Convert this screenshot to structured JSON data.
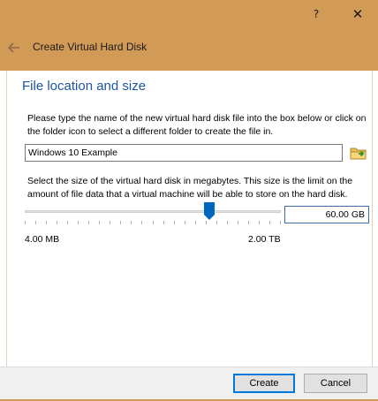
{
  "window": {
    "help_label": "?",
    "close_label": "✕",
    "wizard_title": "Create Virtual Hard Disk",
    "accent_color": "#d29a57"
  },
  "section": {
    "title": "File location and size"
  },
  "file": {
    "description": "Please type the name of the new virtual hard disk file into the box below or click on the folder icon to select a different folder to create the file in.",
    "value": "Windows 10 Example"
  },
  "size": {
    "description": "Select the size of the virtual hard disk in megabytes. This size is the limit on the amount of file data that a virtual machine will be able to store on the hard disk.",
    "value": "60.00 GB",
    "min_label": "4.00 MB",
    "max_label": "2.00 TB",
    "slider_fraction": 0.72
  },
  "buttons": {
    "create": "Create",
    "cancel": "Cancel"
  },
  "icons": {
    "back": "back-arrow-icon",
    "folder": "folder-icon"
  }
}
